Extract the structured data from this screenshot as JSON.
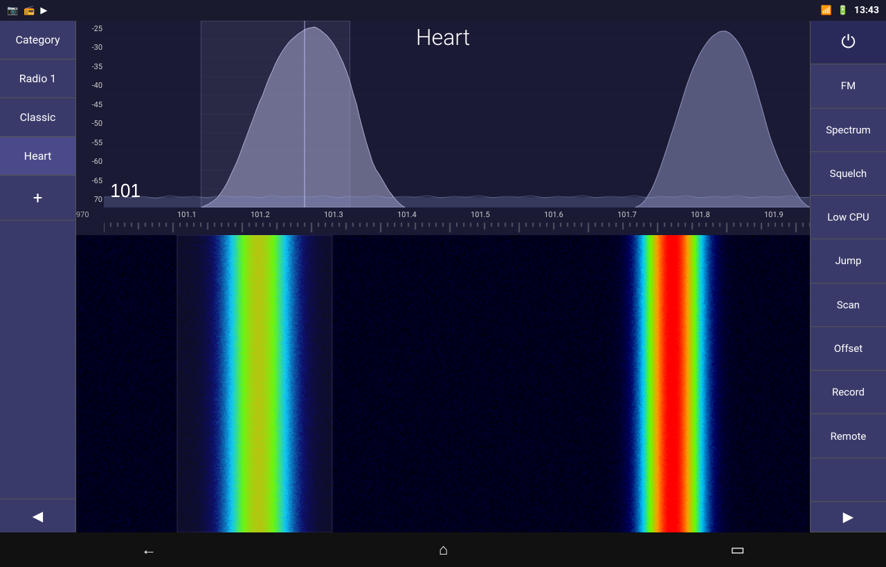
{
  "statusBar": {
    "time": "13:43",
    "icons": [
      "wifi",
      "battery"
    ]
  },
  "sidebar": {
    "items": [
      {
        "label": "Category",
        "id": "category"
      },
      {
        "label": "Radio 1",
        "id": "radio1"
      },
      {
        "label": "Classic",
        "id": "classic"
      },
      {
        "label": "Heart",
        "id": "heart",
        "active": true
      }
    ],
    "addLabel": "+",
    "prevArrow": "◀",
    "nextArrow": "▶"
  },
  "spectrum": {
    "title": "Heart",
    "currentFreq": "101",
    "yLabels": [
      "-25",
      "-30",
      "-35",
      "-40",
      "-45",
      "-50",
      "-55",
      "-60",
      "-65",
      "70"
    ],
    "freqLabels": [
      "101.1",
      "101.2",
      "101.3",
      "101.4",
      "101.5",
      "101.6",
      "101.7",
      "101.8",
      "101.9"
    ],
    "freqStart": "970"
  },
  "rightSidebar": {
    "buttons": [
      {
        "label": "⏻",
        "id": "power",
        "isPower": true
      },
      {
        "label": "FM",
        "id": "fm"
      },
      {
        "label": "Spectrum",
        "id": "spectrum"
      },
      {
        "label": "Squelch",
        "id": "squelch"
      },
      {
        "label": "Low CPU",
        "id": "lowcpu"
      },
      {
        "label": "Jump",
        "id": "jump"
      },
      {
        "label": "Scan",
        "id": "scan"
      },
      {
        "label": "Offset",
        "id": "offset"
      },
      {
        "label": "Record",
        "id": "record"
      },
      {
        "label": "Remote",
        "id": "remote"
      }
    ]
  },
  "navBar": {
    "backIcon": "←",
    "homeIcon": "⌂",
    "recentIcon": "▭"
  }
}
